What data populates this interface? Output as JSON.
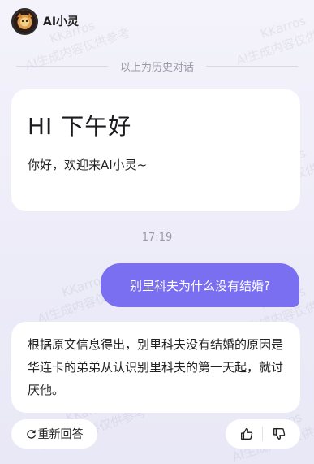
{
  "header": {
    "title": "AI小灵"
  },
  "divider": {
    "text": "以上为历史对话"
  },
  "greeting": {
    "title": "HI 下午好",
    "subtitle": "你好，欢迎来AI小灵~"
  },
  "timestamp": "17:19",
  "user_message": "别里科夫为什么没有结婚?",
  "ai_answer": "根据原文信息得出，别里科夫没有结婚的原因是华连卡的弟弟从认识别里科夫的第一天起，就讨厌他。",
  "actions": {
    "regenerate_label": "重新回答"
  },
  "watermark": {
    "line1": "KKarros",
    "line2": "AI生成内容仅供参考"
  },
  "colors": {
    "accent": "#7a6ff1",
    "background": "#eeedf9"
  },
  "icons": {
    "avatar": "avatar-icon",
    "regenerate": "refresh-icon",
    "like": "thumbs-up-icon",
    "dislike": "thumbs-down-icon"
  }
}
